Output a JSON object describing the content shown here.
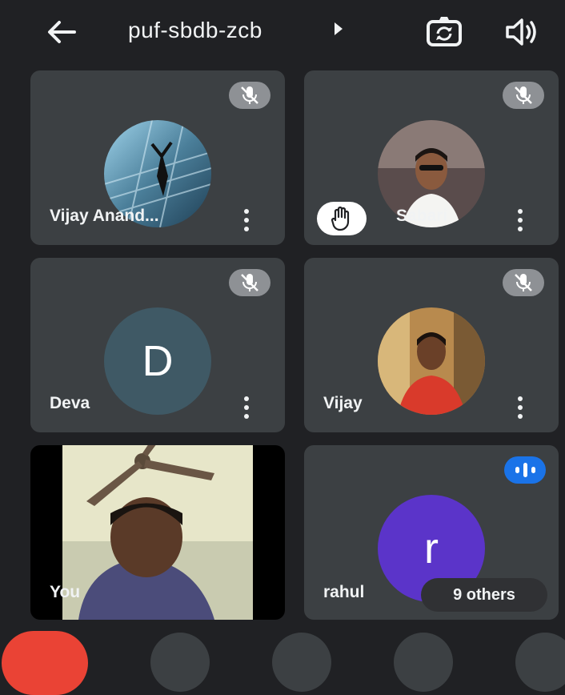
{
  "header": {
    "meeting_code": "puf-sbdb-zcb",
    "back_icon": "arrow-left-icon",
    "switch_camera_icon": "camera-switch-icon",
    "speaker_icon": "speaker-icon"
  },
  "participants": [
    {
      "name": "Vijay Anand...",
      "muted": true,
      "avatar": "photo"
    },
    {
      "name": "Sabari",
      "muted": true,
      "avatar": "photo",
      "hand_raised": true
    },
    {
      "name": "Deva",
      "muted": true,
      "avatar": "letter",
      "initial": "D",
      "avatar_color": "#3f5965"
    },
    {
      "name": "Vijay",
      "muted": true,
      "avatar": "photo"
    },
    {
      "name": "You",
      "self_view": true
    },
    {
      "name": "rahul",
      "speaking": true,
      "avatar": "letter",
      "initial": "r",
      "avatar_color": "#5b34c9"
    }
  ],
  "others_chip": {
    "label": "9 others"
  },
  "colors": {
    "background": "#202124",
    "tile": "#3c4043",
    "end_call": "#ea4335",
    "speaking": "#1a73e8"
  }
}
